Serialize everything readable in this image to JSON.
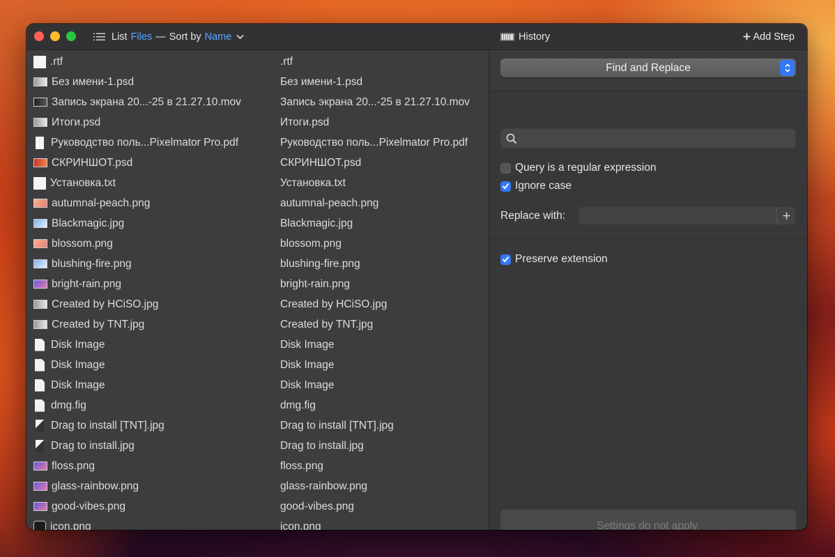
{
  "titlebar": {
    "list_label": "List",
    "files_label": "Files",
    "dash": "—",
    "sort_by_label": "Sort by",
    "name_label": "Name",
    "history_label": "History",
    "add_step_label": "Add Step"
  },
  "files": [
    {
      "name": ".rtf",
      "new_name": ".rtf",
      "icon": "blank"
    },
    {
      "name": "Без имени-1.psd",
      "new_name": "Без имени-1.psd",
      "icon": "thumb"
    },
    {
      "name": "Запись экрана 20...-25 в 21.27.10.mov",
      "new_name": "Запись экрана 20...-25 в 21.27.10.mov",
      "icon": "thumb-dark"
    },
    {
      "name": "Итоги.psd",
      "new_name": "Итоги.psd",
      "icon": "thumb"
    },
    {
      "name": "Руководство поль...Pixelmator Pro.pdf",
      "new_name": "Руководство поль...Pixelmator Pro.pdf",
      "icon": "tall"
    },
    {
      "name": "СКРИНШОТ.psd",
      "new_name": "СКРИНШОТ.psd",
      "icon": "thumb-red"
    },
    {
      "name": "Установка.txt",
      "new_name": "Установка.txt",
      "icon": "blank"
    },
    {
      "name": "autumnal-peach.png",
      "new_name": "autumnal-peach.png",
      "icon": "thumb-peach"
    },
    {
      "name": "Blackmagic.jpg",
      "new_name": "Blackmagic.jpg",
      "icon": "thumb-blue"
    },
    {
      "name": "blossom.png",
      "new_name": "blossom.png",
      "icon": "thumb-peach"
    },
    {
      "name": "blushing-fire.png",
      "new_name": "blushing-fire.png",
      "icon": "thumb-blue"
    },
    {
      "name": "bright-rain.png",
      "new_name": "bright-rain.png",
      "icon": "thumb-purple"
    },
    {
      "name": "Created by HCiSO.jpg",
      "new_name": "Created by HCiSO.jpg",
      "icon": "thumb"
    },
    {
      "name": "Created by TNT.jpg",
      "new_name": "Created by TNT.jpg",
      "icon": "thumb"
    },
    {
      "name": "Disk Image",
      "new_name": "Disk Image",
      "icon": "doc"
    },
    {
      "name": "Disk Image",
      "new_name": "Disk Image",
      "icon": "doc"
    },
    {
      "name": "Disk Image",
      "new_name": "Disk Image",
      "icon": "doc"
    },
    {
      "name": "dmg.fig",
      "new_name": "dmg.fig",
      "icon": "doc"
    },
    {
      "name": "Drag to install [TNT].jpg",
      "new_name": "Drag to install [TNT].jpg",
      "icon": "tall-dark"
    },
    {
      "name": "Drag to install.jpg",
      "new_name": "Drag to install.jpg",
      "icon": "tall-dark"
    },
    {
      "name": "floss.png",
      "new_name": "floss.png",
      "icon": "thumb-purple"
    },
    {
      "name": "glass-rainbow.png",
      "new_name": "glass-rainbow.png",
      "icon": "thumb-purple"
    },
    {
      "name": "good-vibes.png",
      "new_name": "good-vibes.png",
      "icon": "thumb-purple"
    },
    {
      "name": "icon.png",
      "new_name": "icon.png",
      "icon": "round"
    }
  ],
  "step": {
    "selected": "Find and Replace",
    "search_placeholder": "",
    "regex_label": "Query is a regular expression",
    "regex_checked": false,
    "ignore_case_label": "Ignore case",
    "ignore_case_checked": true,
    "replace_label": "Replace with:",
    "replace_value": "",
    "preserve_label": "Preserve extension",
    "preserve_checked": true,
    "settings_note": "Settings do not apply."
  },
  "colors": {
    "accent": "#5aa4ff",
    "checkbox_on": "#3478f6"
  }
}
